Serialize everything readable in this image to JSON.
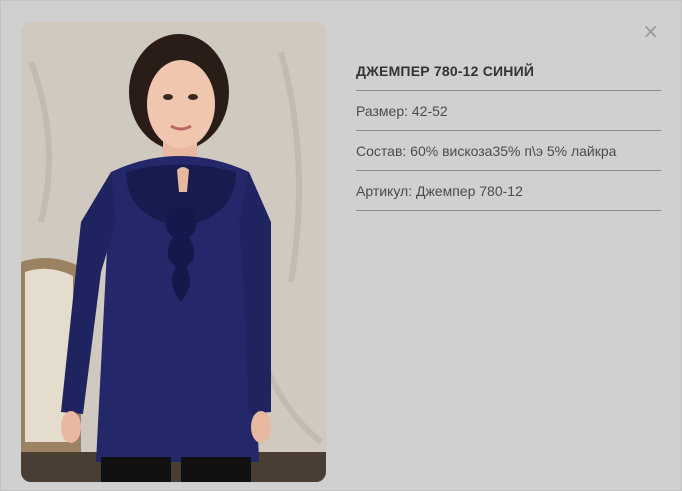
{
  "product": {
    "title": "ДЖЕМПЕР 780-12 СИНИЙ",
    "size": "Размер: 42-52",
    "composition": "Состав: 60% вискоза35% п\\э 5% лайкра",
    "article": "Артикул: Джемпер 780-12"
  },
  "close_symbol": "×",
  "colors": {
    "garment": "#24286a",
    "background_overlay": "#d0d0d0"
  }
}
